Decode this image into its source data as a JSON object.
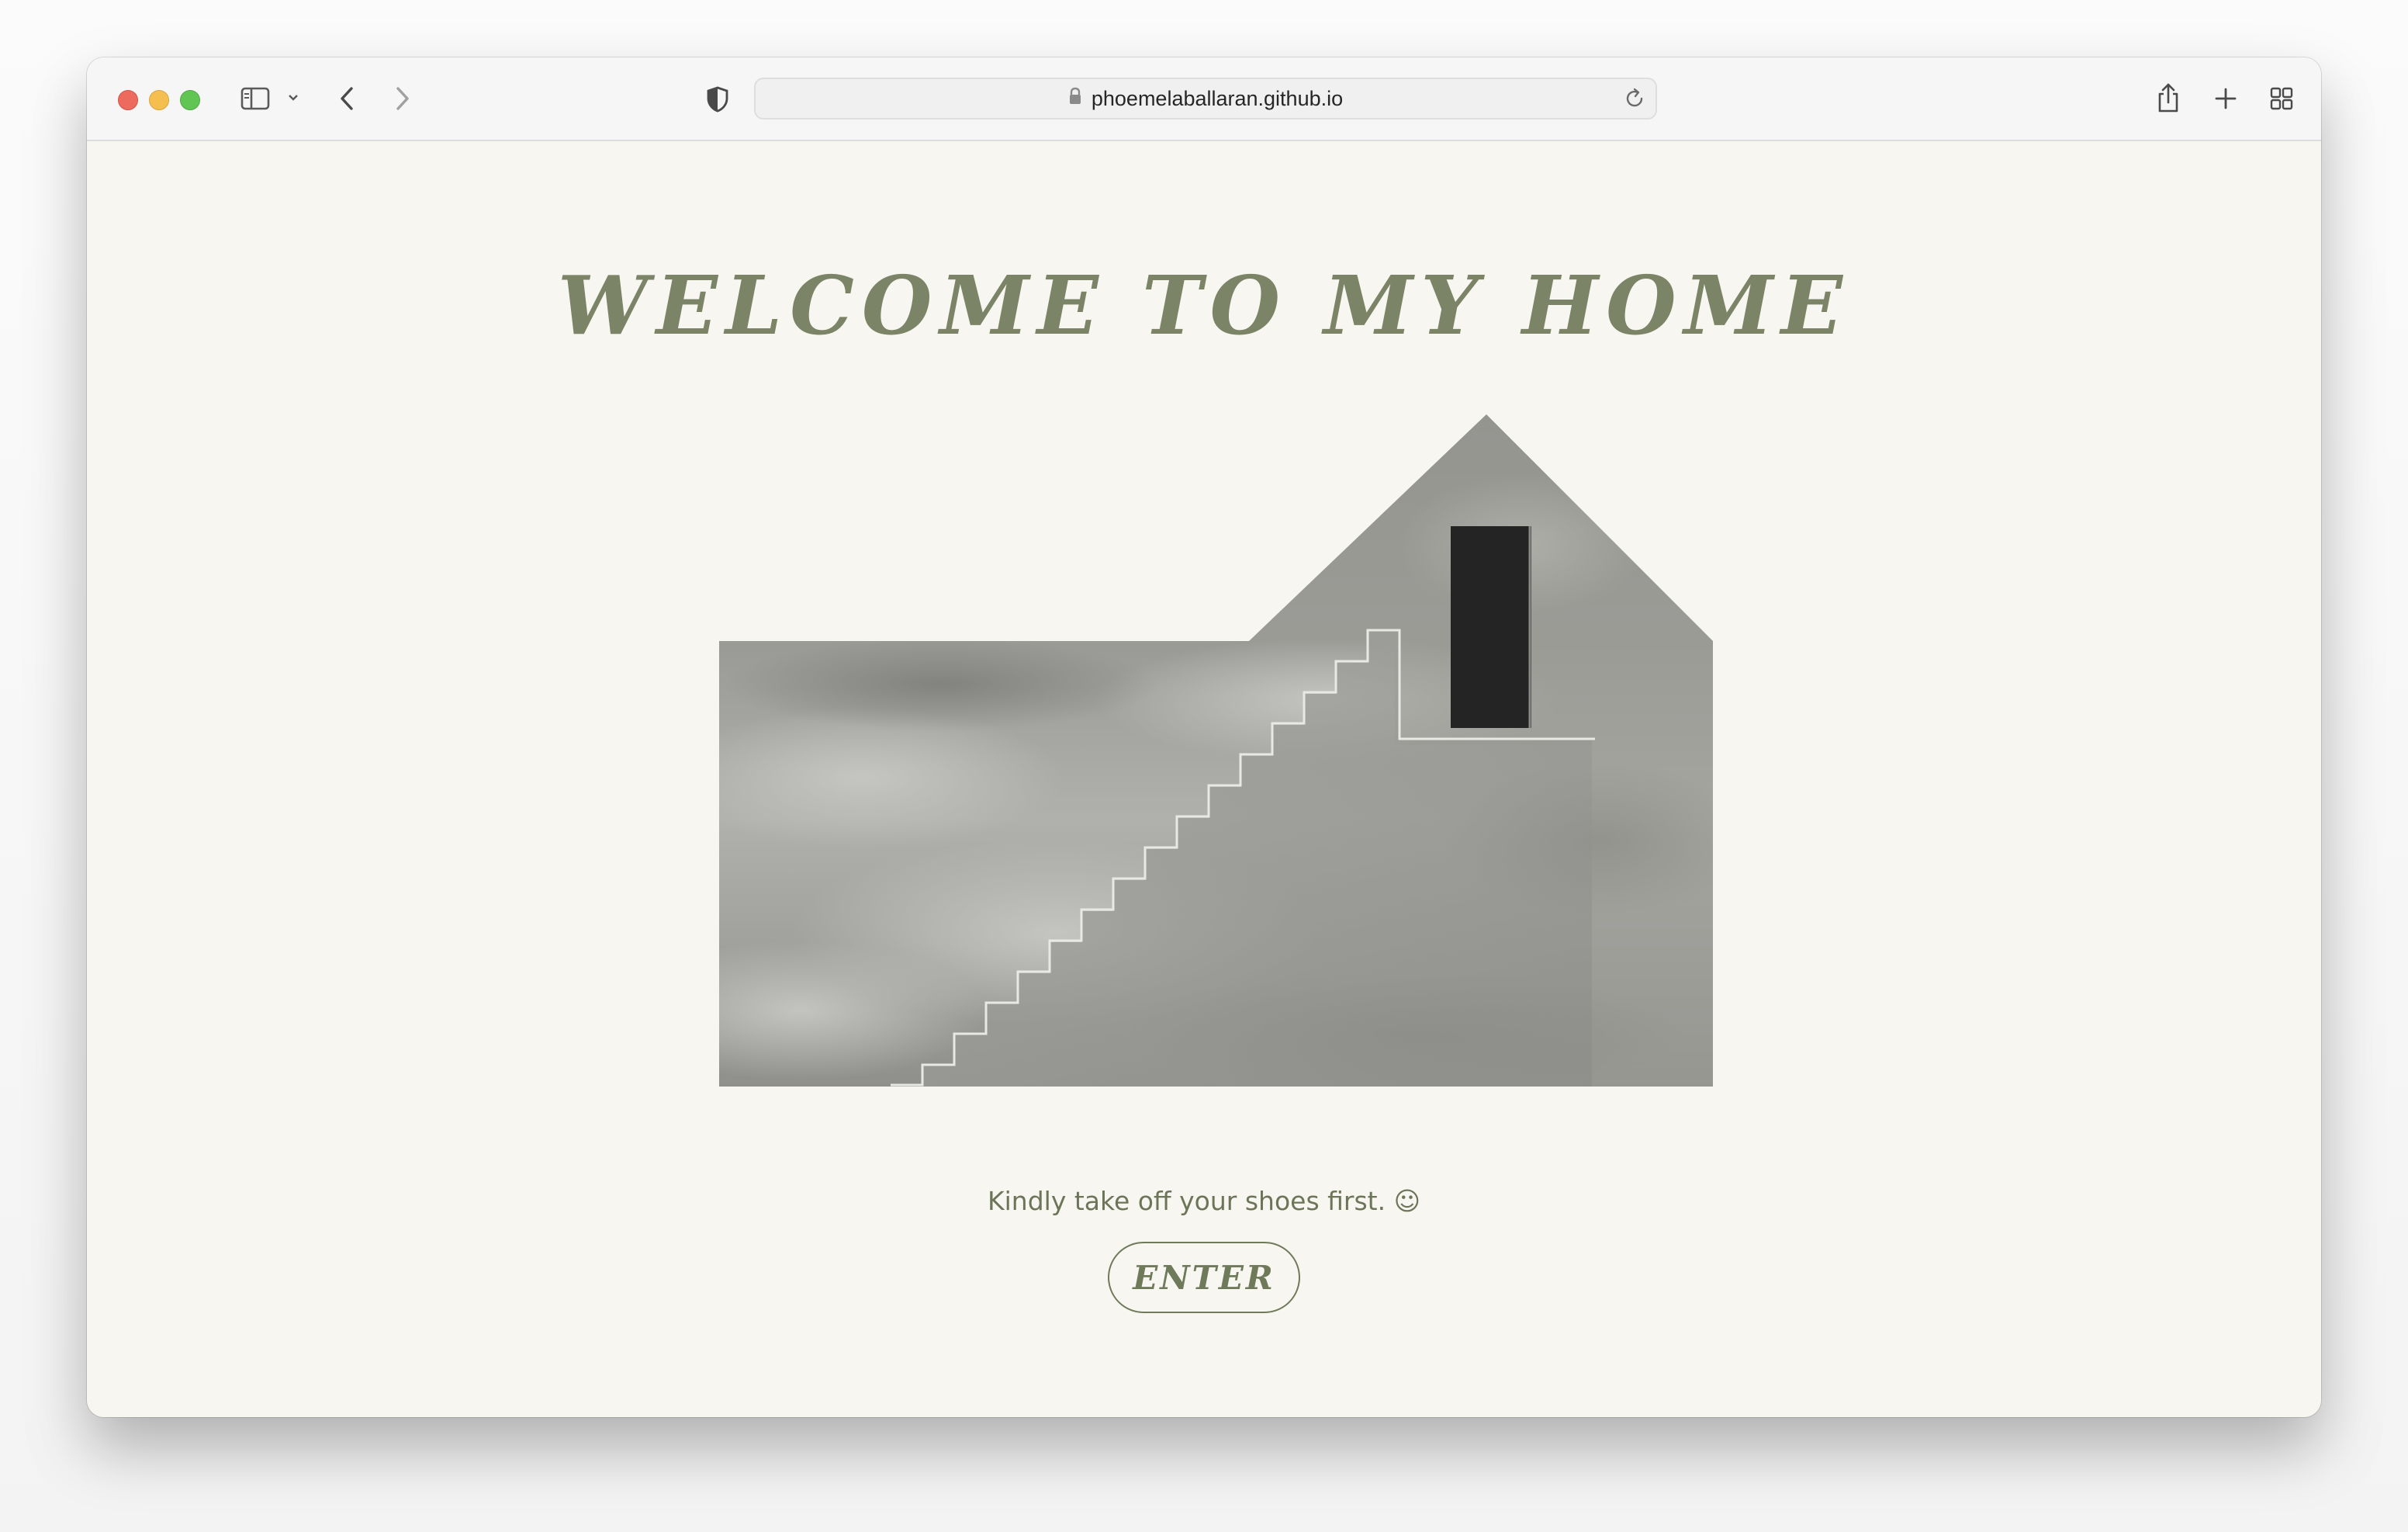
{
  "browser": {
    "url": "phoemelaballaran.github.io",
    "icons": {
      "sidebar": "sidebar-icon",
      "chevron": "chevron-down-icon",
      "back": "back-icon",
      "forward": "forward-icon",
      "privacy": "shield-icon",
      "lock": "lock-icon",
      "reload": "reload-icon",
      "share": "share-icon",
      "new_tab": "plus-icon",
      "tabs": "tab-overview-icon"
    }
  },
  "page": {
    "headline": "WELCOME TO MY HOME",
    "tagline": "Kindly take off your shoes first. ☺",
    "enter_label": "ENTER",
    "accent_color": "#7b8466",
    "background_color": "#f8f6f0"
  }
}
